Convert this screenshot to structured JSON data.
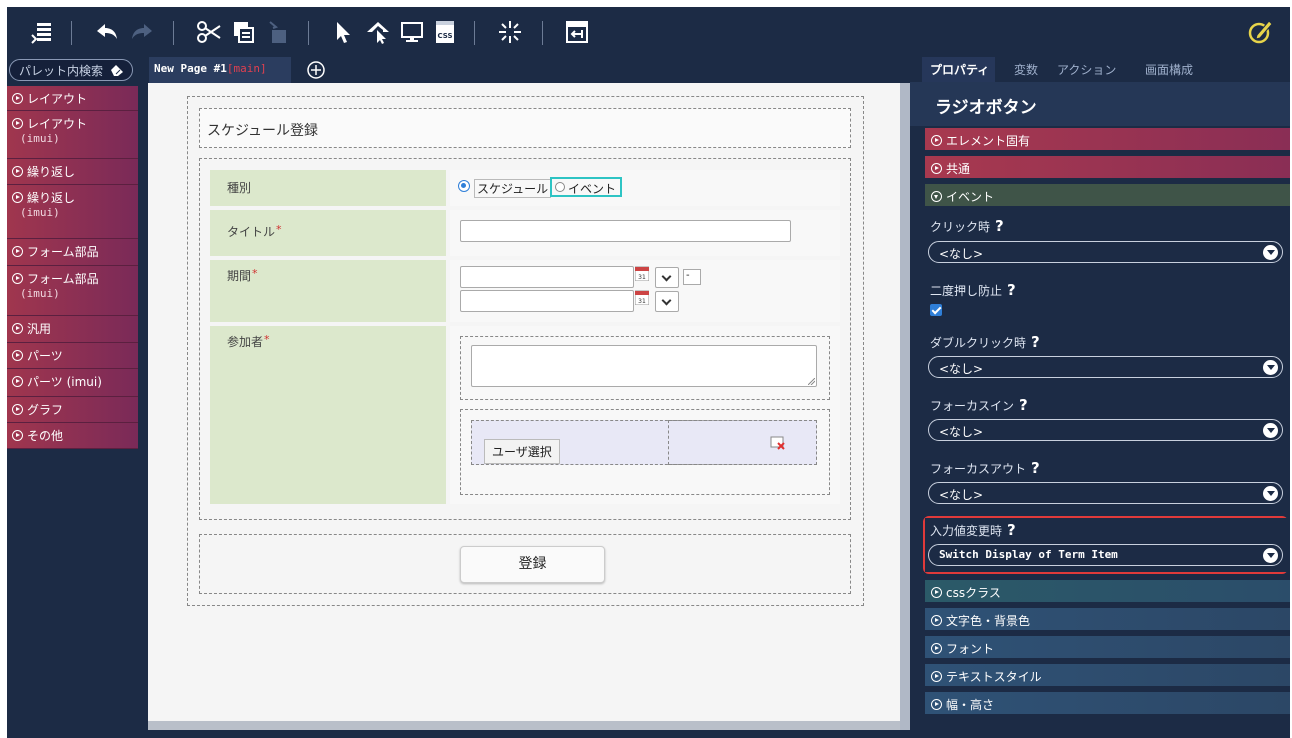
{
  "toolbar": {
    "icons": [
      "database-icon",
      "undo-icon",
      "redo-icon",
      "cut-icon",
      "copy-icon",
      "paste-icon",
      "select-pointer-icon",
      "move-pointer-icon",
      "preview-monitor-icon",
      "css-file-icon",
      "sparkle-icon",
      "exit-icon",
      "pencil-edit-icon"
    ]
  },
  "palette": {
    "search_placeholder": "パレット内検索",
    "items": [
      {
        "label": "レイアウト",
        "sub": ""
      },
      {
        "label": "レイアウト",
        "sub": "(imui)"
      },
      {
        "label": "繰り返し",
        "sub": ""
      },
      {
        "label": "繰り返し",
        "sub": "(imui)"
      },
      {
        "label": "フォーム部品",
        "sub": ""
      },
      {
        "label": "フォーム部品",
        "sub": "(imui)"
      },
      {
        "label": "汎用",
        "sub": ""
      },
      {
        "label": "パーツ",
        "sub": ""
      },
      {
        "label": "パーツ (imui)",
        "sub": ""
      },
      {
        "label": "グラフ",
        "sub": ""
      },
      {
        "label": "その他",
        "sub": ""
      }
    ]
  },
  "tabs": {
    "page_name": "New Page #1",
    "page_tag": "[main]"
  },
  "form": {
    "title": "スケジュール登録",
    "rows": {
      "type_label": "種別",
      "title_label": "タイトル",
      "period_label": "期間",
      "participants_label": "参加者"
    },
    "required_mark": "*",
    "radio_schedule": "スケジュール",
    "radio_event": "イベント",
    "period_separator": "-",
    "user_select_button": "ユーザ選択",
    "submit_button": "登録"
  },
  "props": {
    "tabs": [
      "プロパティ",
      "変数",
      "アクション",
      "画面構成"
    ],
    "title": "ラジオボタン",
    "sections_top": [
      "エレメント固有",
      "共通",
      "イベント"
    ],
    "events": {
      "click_label": "クリック時",
      "click_value": "<なし>",
      "double_submit_label": "二度押し防止",
      "double_submit_checked": true,
      "dblclick_label": "ダブルクリック時",
      "dblclick_value": "<なし>",
      "focusin_label": "フォーカスイン",
      "focusin_value": "<なし>",
      "focusout_label": "フォーカスアウト",
      "focusout_value": "<なし>",
      "change_label": "入力値変更時",
      "change_value": "Switch Display of Term Item"
    },
    "help_mark": "?",
    "sections_bottom": [
      "cssクラス",
      "文字色・背景色",
      "フォント",
      "テキストスタイル",
      "幅・高さ"
    ]
  },
  "colors": {
    "background": "#1c2b45",
    "palette_item": "#a0364e",
    "highlight": "#e03a3a",
    "form_label_bg": "#dce8cc",
    "radio_focus": "#2ec4c4"
  }
}
